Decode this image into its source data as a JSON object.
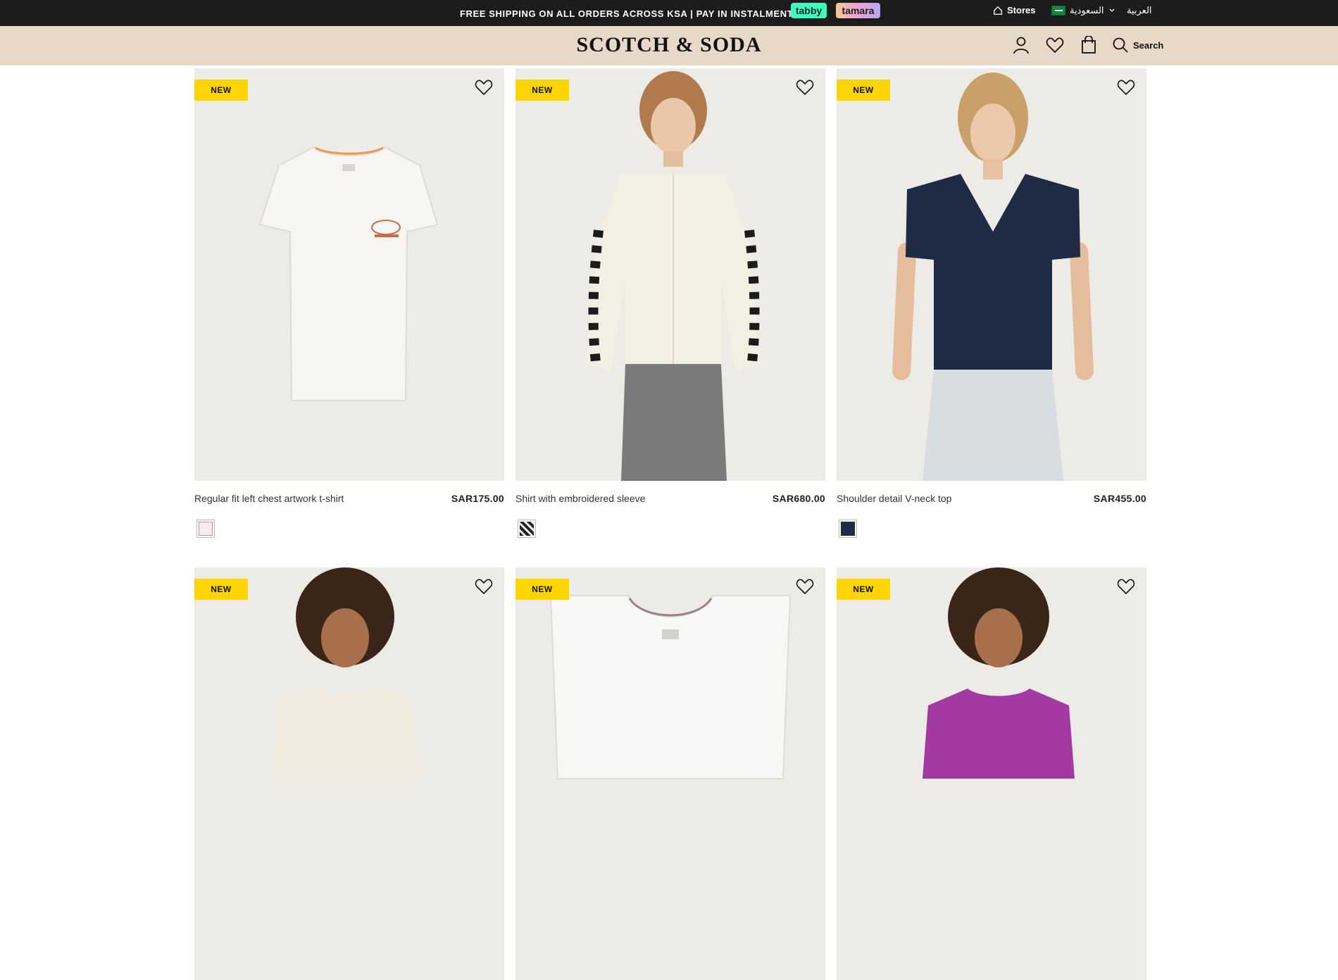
{
  "promo": {
    "text": "FREE SHIPPING ON ALL ORDERS ACROSS KSA | PAY IN INSTALMENTS",
    "tabby": "tabby",
    "tamara": "tamara"
  },
  "topbar": {
    "stores": "Stores",
    "country": "السعودية",
    "language": "العربية"
  },
  "header": {
    "logo": "SCOTCH & SODA",
    "search_label": "Search"
  },
  "colors": {
    "promo_bg": "#1c1c1c",
    "header_bg": "#e8d8c7",
    "new_badge": "#ffd500",
    "image_bg": "#ecebe6"
  },
  "products": [
    {
      "badge": "NEW",
      "name": "Regular fit left chest artwork t-shirt",
      "price": "SAR175.00",
      "swatch": "#f1efee"
    },
    {
      "badge": "NEW",
      "name": "Shirt with embroidered sleeve",
      "price": "SAR680.00",
      "swatch": "#2a2a2a"
    },
    {
      "badge": "NEW",
      "name": "Shoulder detail V-neck top",
      "price": "SAR455.00",
      "swatch": "#1f2a44"
    },
    {
      "badge": "NEW"
    },
    {
      "badge": "NEW"
    },
    {
      "badge": "NEW"
    }
  ]
}
